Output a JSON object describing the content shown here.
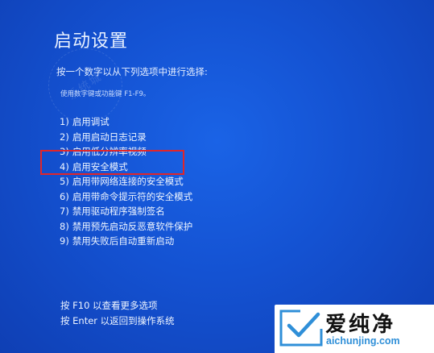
{
  "screen": {
    "title": "启动设置",
    "prompt": "按一个数字以从下列选项中进行选择:",
    "hint": "使用数字键或功能键 F1-F9。",
    "options": [
      {
        "num": "1)",
        "label": "启用调试"
      },
      {
        "num": "2)",
        "label": "启用启动日志记录"
      },
      {
        "num": "3)",
        "label": "启用低分辨率视频"
      },
      {
        "num": "4)",
        "label": "启用安全模式"
      },
      {
        "num": "5)",
        "label": "启用带网络连接的安全模式"
      },
      {
        "num": "6)",
        "label": "启用带命令提示符的安全模式"
      },
      {
        "num": "7)",
        "label": "禁用驱动程序强制签名"
      },
      {
        "num": "8)",
        "label": "禁用预先启动反恶意软件保护"
      },
      {
        "num": "9)",
        "label": "禁用失败后自动重新启动"
      }
    ],
    "footer": [
      "按 F10 以查看更多选项",
      "按 Enter 以返回到操作系统"
    ],
    "highlighted_option": "4)"
  },
  "watermark": {
    "stamp_text": "系统城",
    "logo_name": "爱纯净",
    "logo_url": "aichunjing.com"
  },
  "colors": {
    "background": "#1452d2",
    "highlight_border": "#e0262a",
    "logo_url": "#2f8fd8"
  }
}
